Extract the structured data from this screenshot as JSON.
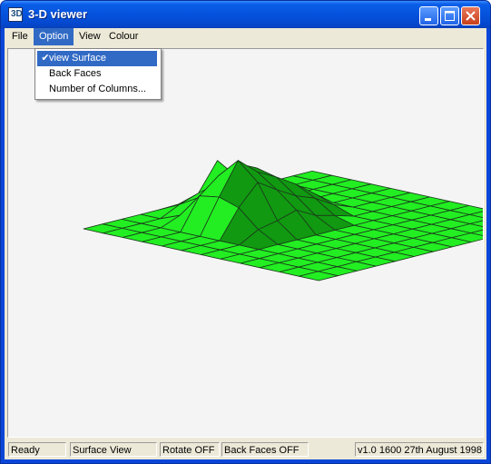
{
  "window": {
    "title": "3-D viewer",
    "icon_text": "3D",
    "icon": "app-3d-icon",
    "controls": [
      "minimize-icon",
      "maximize-icon",
      "close-icon"
    ]
  },
  "menu": {
    "items": [
      "File",
      "Option",
      "View",
      "Colour"
    ],
    "active": "Option"
  },
  "option_menu": {
    "items": [
      {
        "label": "view Surface",
        "checked": true,
        "highlighted": true
      },
      {
        "label": "Back Faces",
        "checked": false,
        "highlighted": false
      },
      {
        "label": "Number of Columns...",
        "checked": false,
        "highlighted": false
      }
    ],
    "check_glyph": "✔"
  },
  "viewport": {
    "content": "3d-surface-mesh",
    "colors": {
      "face": "#22ee22",
      "shade": "#119911",
      "edge": "#1a3a1a",
      "background": "#f4f4f4"
    }
  },
  "status": {
    "ready": "Ready",
    "view": "Surface View",
    "rotate": "Rotate OFF",
    "back_faces": "Back Faces OFF",
    "version": "v1.0 1600 27th August 1998"
  },
  "colors": {
    "titlebar": "#0553dd",
    "menu_highlight": "#316ac5",
    "window_face": "#ece9d8"
  }
}
